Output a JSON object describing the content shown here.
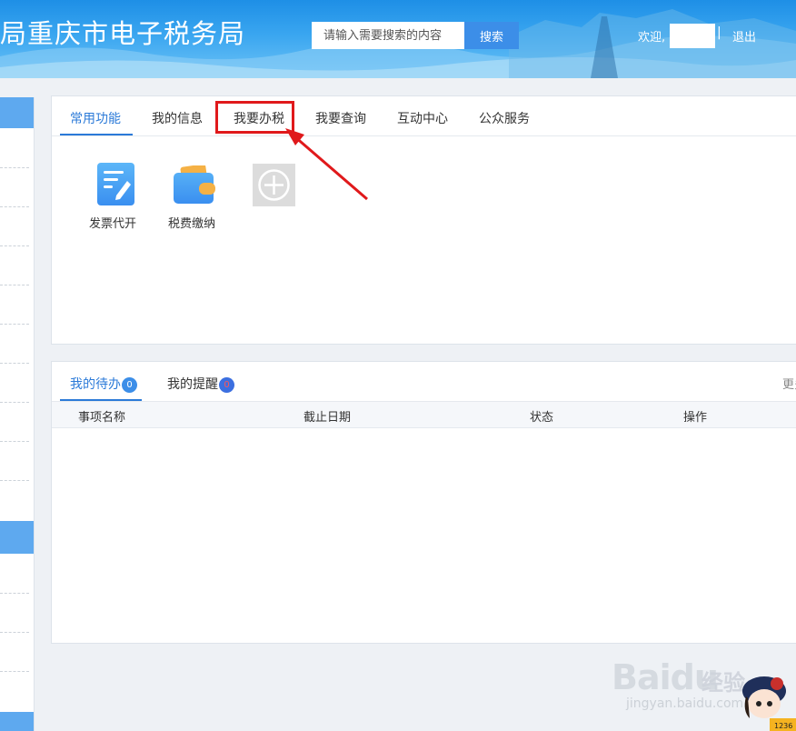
{
  "header": {
    "site_title": "局重庆市电子税务局",
    "search_placeholder": "请输入需要搜索的内容",
    "search_button": "搜索",
    "welcome": "欢迎,",
    "separator": "|",
    "logout": "退出"
  },
  "common_panel": {
    "tabs": [
      {
        "label": "常用功能",
        "active": true
      },
      {
        "label": "我的信息",
        "active": false
      },
      {
        "label": "我要办税",
        "active": false
      },
      {
        "label": "我要查询",
        "active": false
      },
      {
        "label": "互动中心",
        "active": false
      },
      {
        "label": "公众服务",
        "active": false
      }
    ],
    "functions": [
      {
        "label": "发票代开",
        "icon": "invoice-icon"
      },
      {
        "label": "税费缴纳",
        "icon": "wallet-icon"
      }
    ],
    "add_icon": "plus-circle-icon"
  },
  "todo_panel": {
    "tabs": [
      {
        "label": "我的待办",
        "badge": "0",
        "badge_color": "#3c8ee8",
        "active": true
      },
      {
        "label": "我的提醒",
        "badge": "0",
        "badge_color": "#3c6fe0",
        "active": false
      }
    ],
    "more": "更多",
    "columns": [
      "事项名称",
      "截止日期",
      "状态",
      "操作"
    ]
  },
  "watermark": {
    "brand": "Baidu",
    "brand_cn": "经验",
    "url": "jingyan.baidu.com"
  },
  "colors": {
    "accent": "#2b7ad8",
    "highlight": "#e0191b",
    "header_blue": "#3aa6f0"
  }
}
